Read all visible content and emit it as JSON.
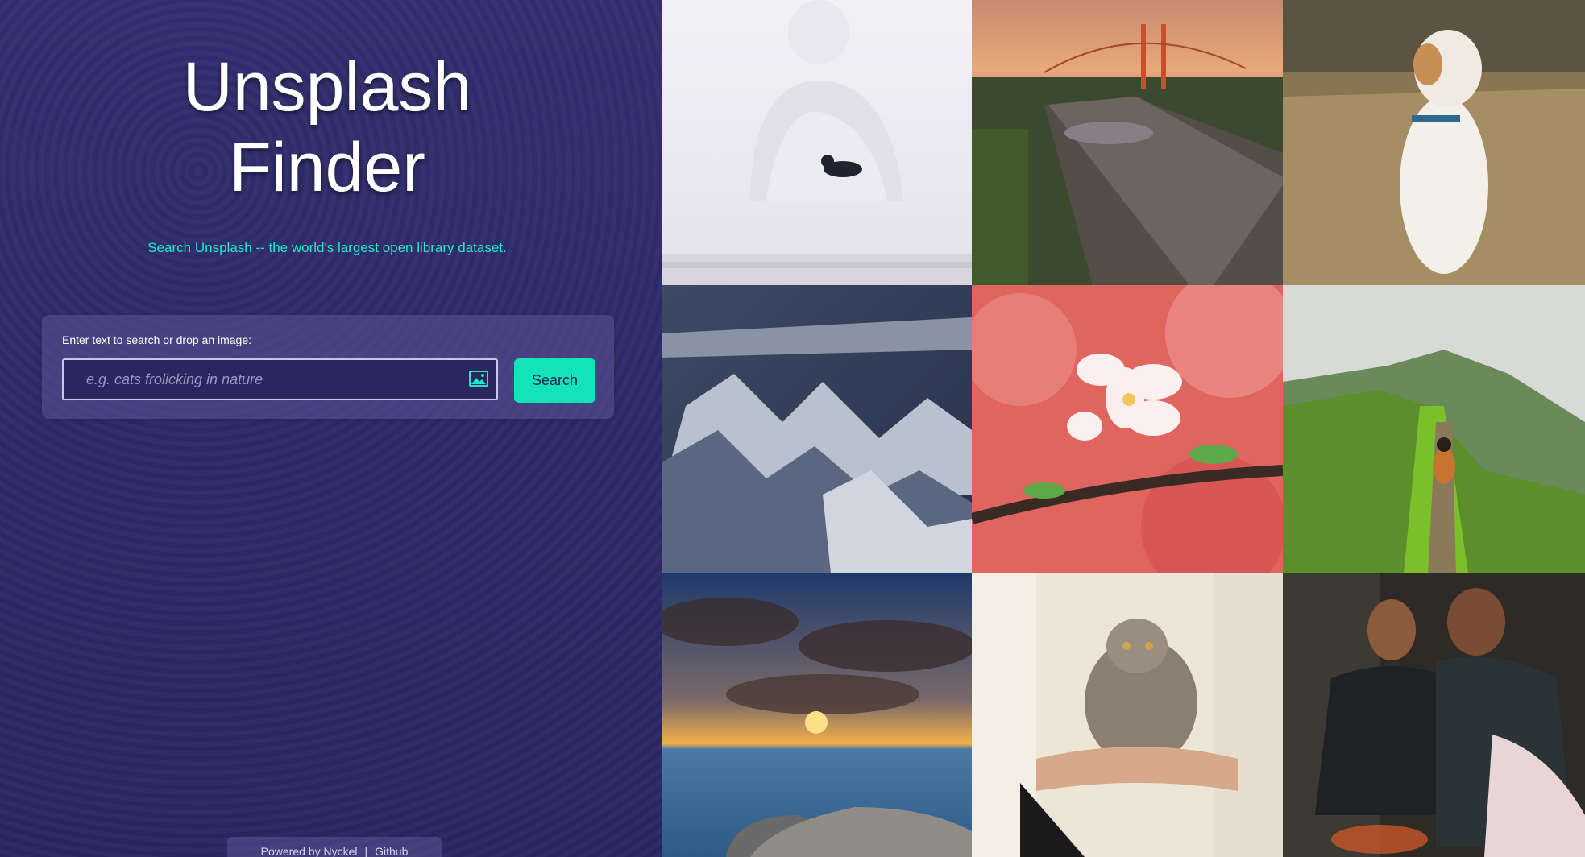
{
  "header": {
    "title_line1": "Unsplash",
    "title_line2": "Finder",
    "subtitle": "Search Unsplash -- the world's largest open library dataset."
  },
  "search": {
    "label": "Enter text to search or drop an image:",
    "placeholder": "e.g. cats frolicking in nature",
    "value": "",
    "button_label": "Search",
    "image_icon": "image-icon"
  },
  "footer": {
    "powered_by": "Powered by Nyckel",
    "separator": "|",
    "github": "Github"
  },
  "gallery": {
    "images": [
      {
        "subject": "statue-with-crow"
      },
      {
        "subject": "golden-gate-bridge-sunset"
      },
      {
        "subject": "dog-in-grass"
      },
      {
        "subject": "snowy-mountains-aerial"
      },
      {
        "subject": "cherry-blossom"
      },
      {
        "subject": "hiker-on-green-ridge"
      },
      {
        "subject": "sunset-over-sea"
      },
      {
        "subject": "kitten-held-in-arms"
      },
      {
        "subject": "couple-by-campfire"
      }
    ]
  },
  "colors": {
    "accent": "#14e2b8",
    "subtitle": "#1de9c8",
    "background": "#2c2869"
  }
}
